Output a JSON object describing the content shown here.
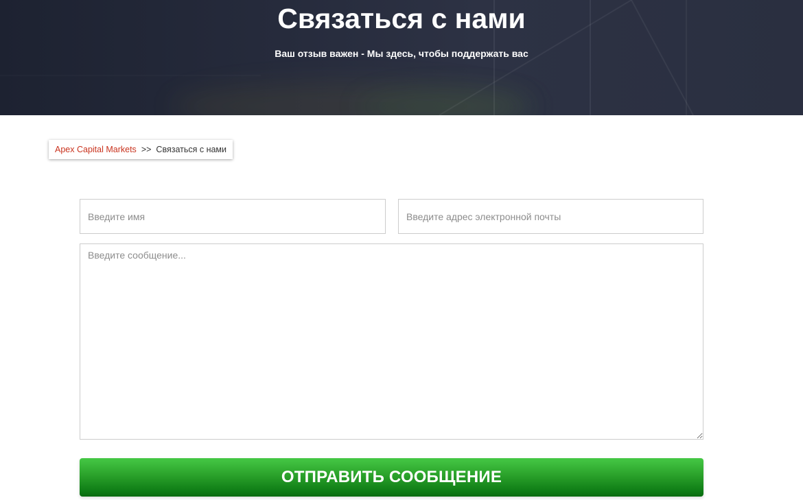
{
  "hero": {
    "title": "Связаться с нами",
    "subtitle": "Ваш отзыв важен - Мы здесь, чтобы поддержать вас"
  },
  "breadcrumb": {
    "home": "Apex Capital Markets",
    "separator": ">>",
    "current": "Связаться с нами"
  },
  "form": {
    "name_placeholder": "Введите имя",
    "email_placeholder": "Введите адрес электронной почты",
    "message_placeholder": "Введите сообщение...",
    "submit_label": "ОТПРАВИТЬ СООБЩЕНИЕ"
  },
  "colors": {
    "hero_bg": "#262b3c",
    "link": "#c9331e",
    "button": "#2aa12a"
  }
}
